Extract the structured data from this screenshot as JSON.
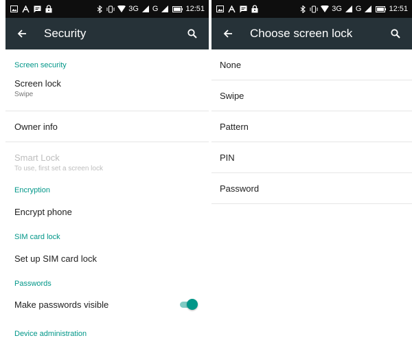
{
  "status_bar": {
    "left_icons": [
      "image-notification-icon",
      "cleaner-notification-icon",
      "message-notification-icon",
      "lock-notification-icon"
    ],
    "right_icons": [
      "bluetooth-icon",
      "vibrate-icon",
      "wifi-icon"
    ],
    "network": "3G",
    "network2": "G",
    "time": "12:51"
  },
  "left_screen": {
    "title": "Security",
    "sections": {
      "screen_security": "Screen security",
      "encryption": "Encryption",
      "sim_card_lock": "SIM card lock",
      "passwords": "Passwords",
      "device_administration": "Device administration"
    },
    "items": {
      "screen_lock": {
        "title": "Screen lock",
        "summary": "Swipe"
      },
      "owner_info": {
        "title": "Owner info"
      },
      "smart_lock": {
        "title": "Smart Lock",
        "summary": "To use, first set a screen lock",
        "enabled": false
      },
      "encrypt_phone": {
        "title": "Encrypt phone"
      },
      "set_up_sim_lock": {
        "title": "Set up SIM card lock"
      },
      "make_passwords_visible": {
        "title": "Make passwords visible",
        "toggle_on": true
      }
    }
  },
  "right_screen": {
    "title": "Choose screen lock",
    "options": [
      "None",
      "Swipe",
      "Pattern",
      "PIN",
      "Password"
    ]
  },
  "colors": {
    "toolbar": "#263238",
    "statusbar": "#0e0e0e",
    "accent": "#009688",
    "accent_track": "#80cbc4"
  }
}
